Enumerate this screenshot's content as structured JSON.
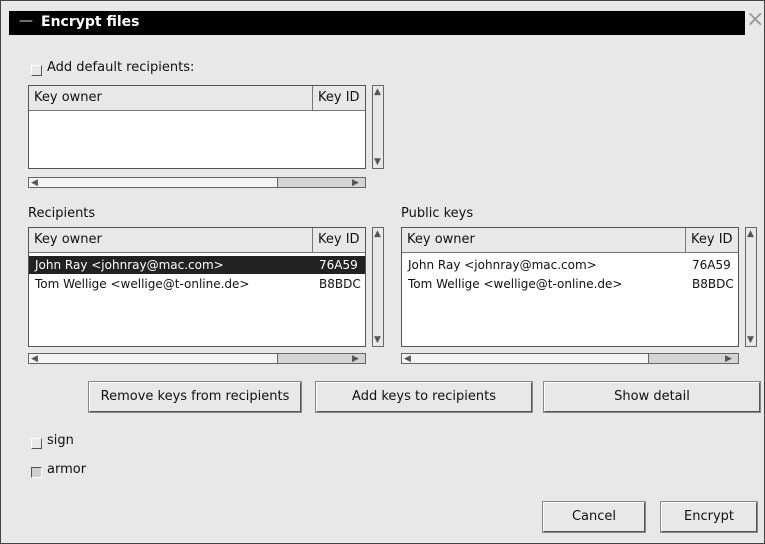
{
  "window": {
    "title": "Encrypt files"
  },
  "default_recipients": {
    "checkbox_label": "Add default recipients:",
    "checked": false,
    "columns": [
      "Key owner",
      "Key ID"
    ],
    "rows": []
  },
  "recipients": {
    "label": "Recipients",
    "columns": [
      "Key owner",
      "Key ID"
    ],
    "rows": [
      {
        "owner": "John Ray <johnray@mac.com>",
        "key_id": "76A59",
        "selected": true
      },
      {
        "owner": "Tom Wellige <wellige@t-online.de>",
        "key_id": "B8BDC",
        "selected": false
      }
    ]
  },
  "public_keys": {
    "label": "Public keys",
    "columns": [
      "Key owner",
      "Key ID"
    ],
    "rows": [
      {
        "owner": "John Ray <johnray@mac.com>",
        "key_id": "76A59"
      },
      {
        "owner": "Tom Wellige <wellige@t-online.de>",
        "key_id": "B8BDC"
      }
    ]
  },
  "buttons": {
    "remove": "Remove keys from recipients",
    "add": "Add keys to recipients",
    "detail": "Show detail",
    "cancel": "Cancel",
    "encrypt": "Encrypt"
  },
  "options": {
    "sign": {
      "label": "sign",
      "checked": false
    },
    "armor": {
      "label": "armor",
      "checked": true
    }
  }
}
